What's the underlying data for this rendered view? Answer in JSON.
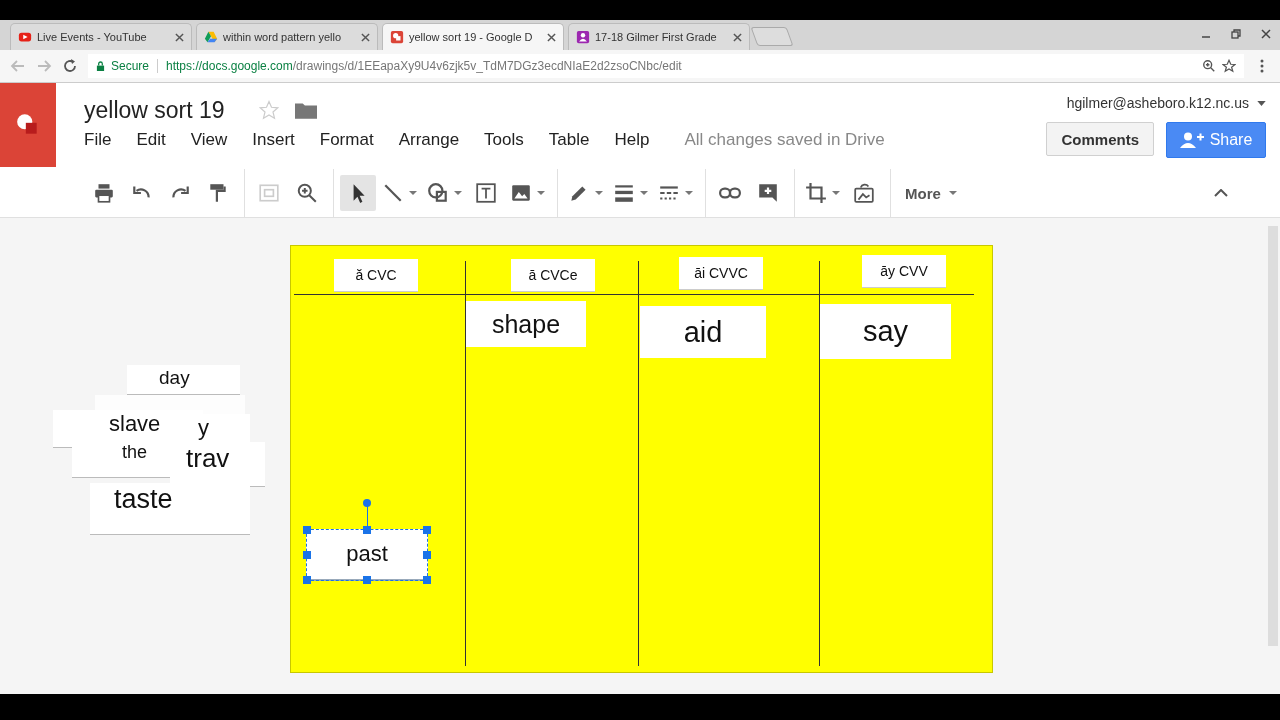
{
  "browser": {
    "tabs": [
      {
        "title": "Live Events - YouTube",
        "kind": "youtube",
        "selected": false
      },
      {
        "title": "within word pattern yello",
        "kind": "drive",
        "selected": false
      },
      {
        "title": "yellow sort 19 - Google D",
        "kind": "drawings",
        "selected": true
      },
      {
        "title": "17-18 Gilmer First Grade",
        "kind": "classroom",
        "selected": false
      }
    ],
    "secure_label": "Secure",
    "url_host": "https://docs.google.com",
    "url_path": "/drawings/d/1EEapaXy9U4v6zjk5v_TdM7DGz3ecdNIaE2d2zsoCNbc/edit"
  },
  "document": {
    "title": "yellow sort 19",
    "starred": false
  },
  "menu": [
    "File",
    "Edit",
    "View",
    "Insert",
    "Format",
    "Arrange",
    "Tools",
    "Table",
    "Help"
  ],
  "save_status": "All changes saved in Drive",
  "account": "hgilmer@asheboro.k12.nc.us",
  "comments_button": "Comments",
  "share_button": "Share",
  "more_button": "More",
  "board": {
    "columns": [
      {
        "label": "ă CVC"
      },
      {
        "label": "ā CVCe"
      },
      {
        "label": "āi CVVC"
      },
      {
        "label": "āy CVV"
      }
    ],
    "cards": [
      {
        "word": "shape",
        "selected": false
      },
      {
        "word": "aid",
        "selected": false
      },
      {
        "word": "say",
        "selected": false
      },
      {
        "word": "past",
        "selected": true
      }
    ]
  },
  "loose_cards": [
    {
      "kind": "word",
      "word": "day"
    },
    {
      "kind": "covered"
    },
    {
      "kind": "word",
      "word": "slave"
    },
    {
      "kind": "word",
      "word": "y"
    },
    {
      "kind": "word",
      "word": "the"
    },
    {
      "kind": "word",
      "word": "trav"
    },
    {
      "kind": "word",
      "word": "taste"
    }
  ]
}
